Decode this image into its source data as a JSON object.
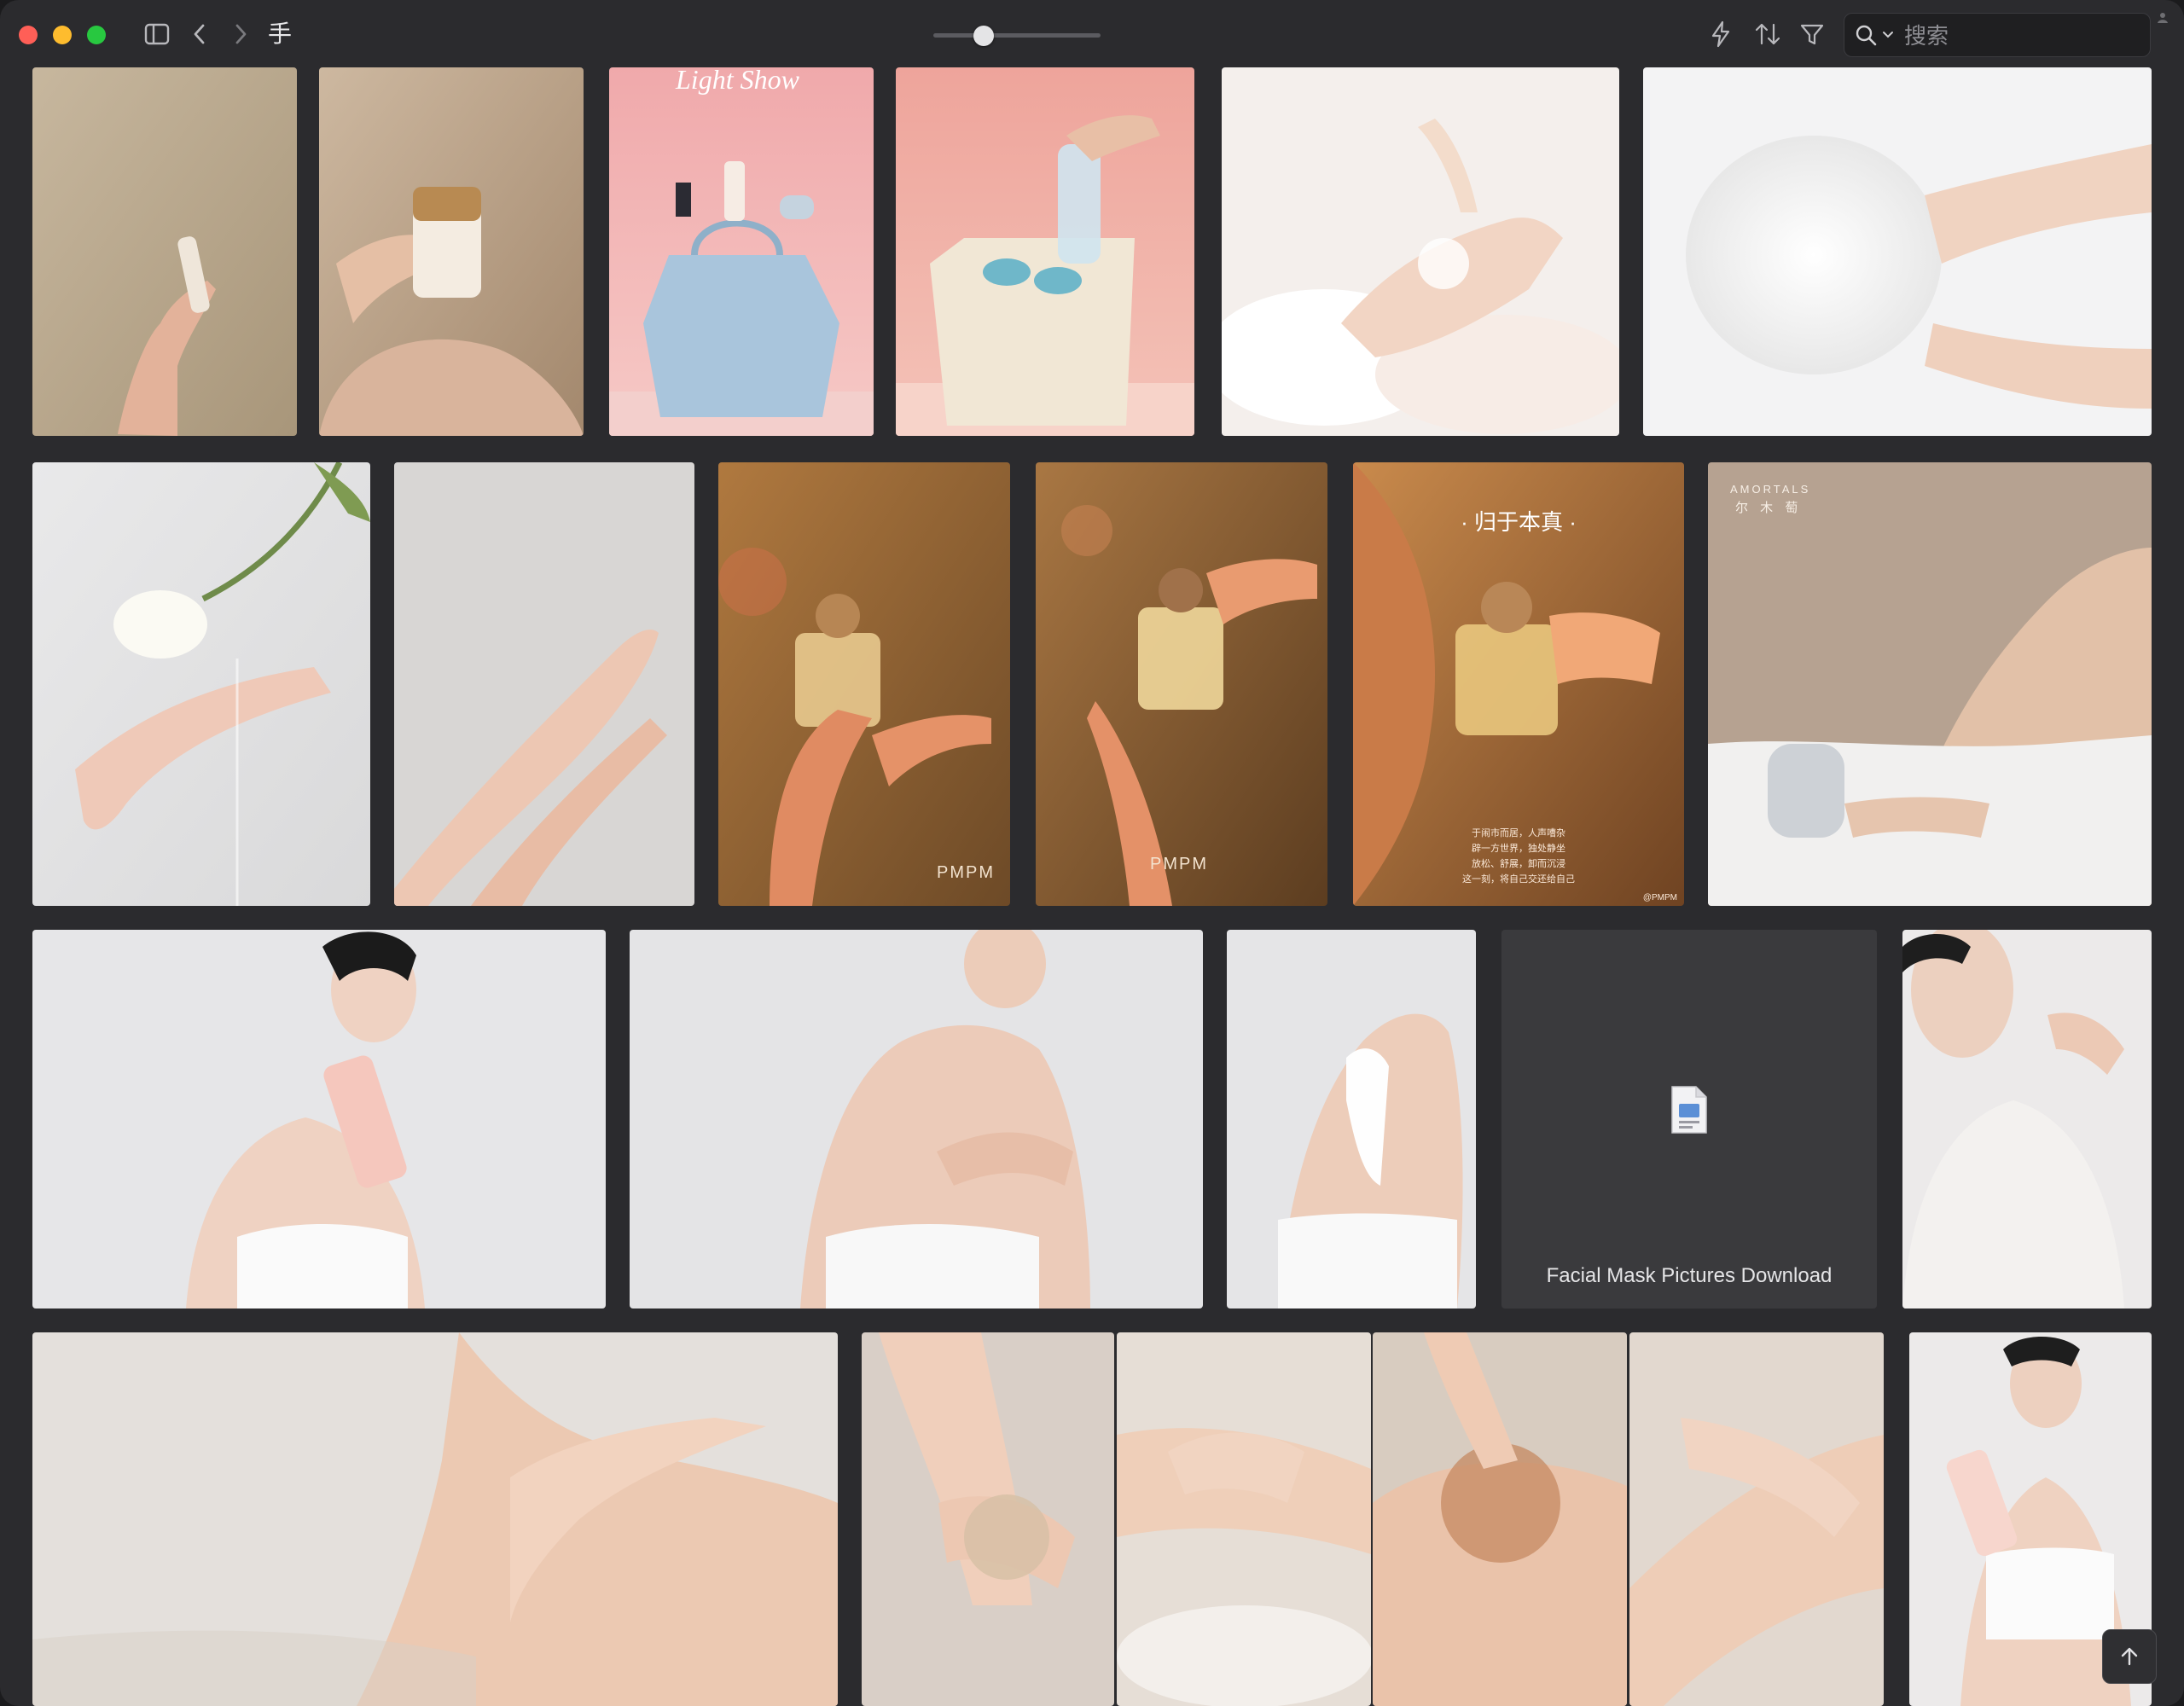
{
  "window": {
    "title": "手",
    "search_placeholder": "搜索"
  },
  "colors": {
    "window_bg": "#2b2b2e",
    "close": "#ff5f57",
    "minimize": "#febc2e",
    "zoom": "#28c840"
  },
  "toolbar": {
    "icons": [
      "sidebar-toggle-icon",
      "back-icon",
      "forward-icon",
      "lightning-icon",
      "sort-icon",
      "filter-icon",
      "search-icon"
    ],
    "zoom_level": 0.3
  },
  "tiles": {
    "t3_title": "Light Show",
    "t9_logo": "PMPM",
    "t10_logo": "PMPM",
    "t11_heading": "· 归于本真 ·",
    "t11_caption_1": "于闹市而居，人声嘈杂",
    "t11_caption_2": "辟一方世界，独处静坐",
    "t11_caption_3": "放松、舒展，卸而沉浸",
    "t11_caption_4": "这一刻，将自己交还给自己",
    "t11_watermark": "@PMPM",
    "t12_brand": "AMORTALS",
    "t12_brand_cn": "尔 木 萄",
    "doc_title": "Facial Mask Pictures Download"
  }
}
